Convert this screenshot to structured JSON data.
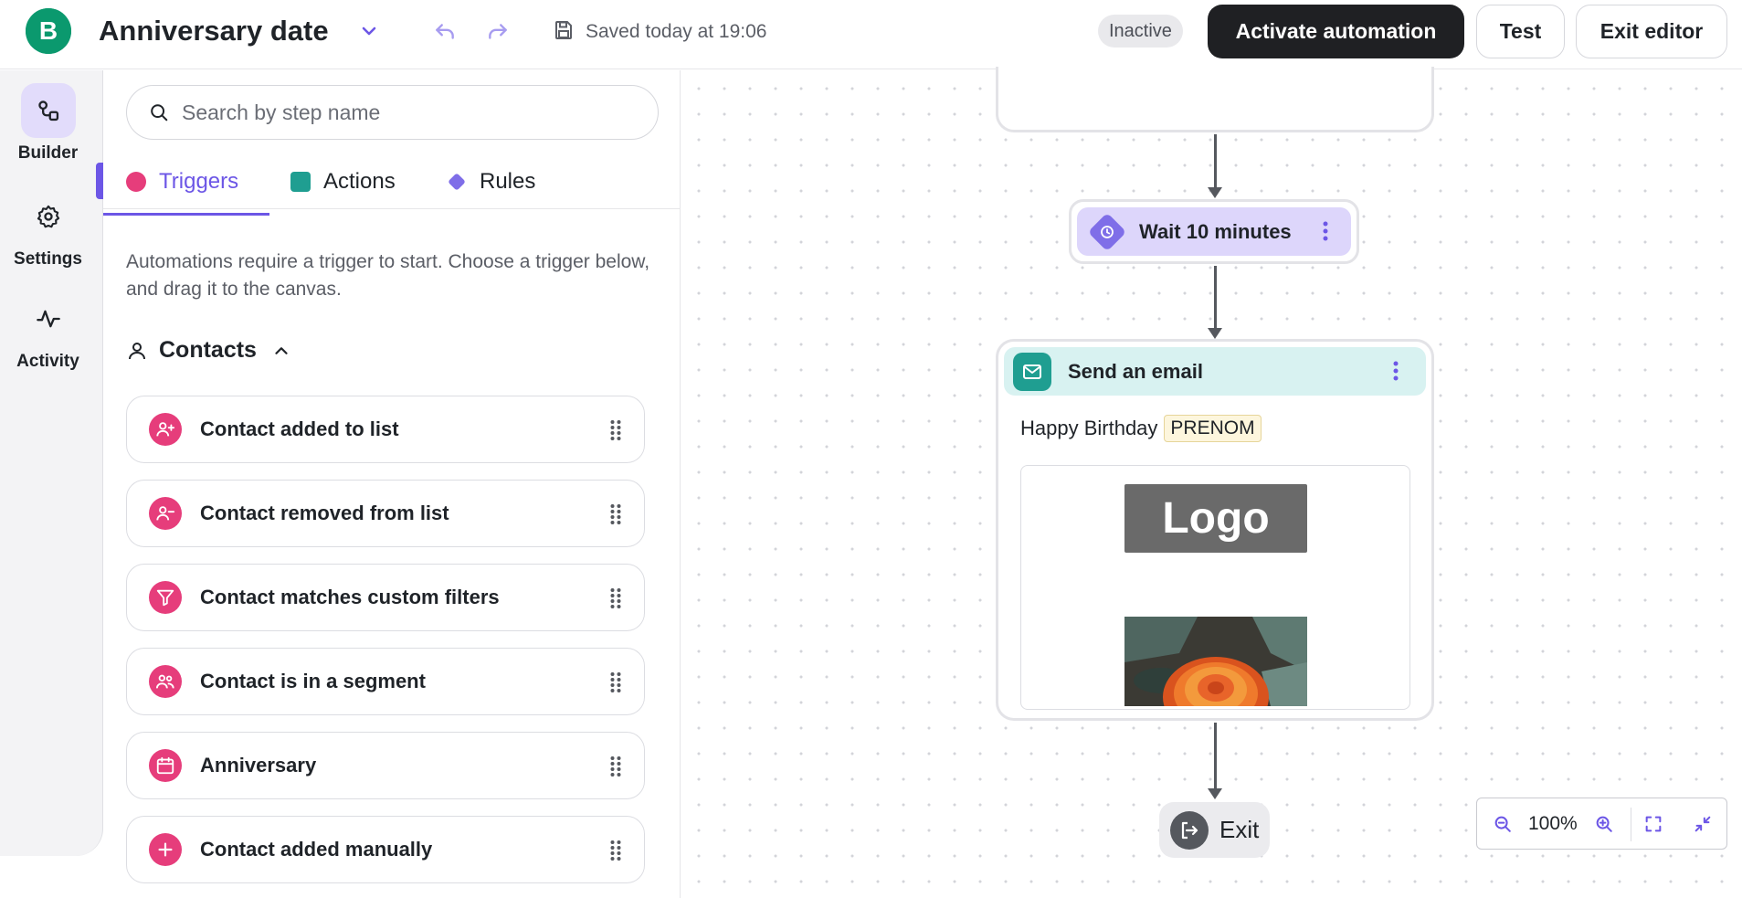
{
  "header": {
    "brand_letter": "B",
    "title": "Anniversary date",
    "saved_text": "Saved today at 19:06",
    "status_badge": "Inactive",
    "activate_label": "Activate automation",
    "test_label": "Test",
    "exit_editor_label": "Exit editor"
  },
  "rail": {
    "items": [
      {
        "label": "Builder",
        "icon": "builder-icon",
        "active": true
      },
      {
        "label": "Settings",
        "icon": "gear-icon",
        "active": false
      },
      {
        "label": "Activity",
        "icon": "activity-icon",
        "active": false
      }
    ]
  },
  "panel": {
    "search_placeholder": "Search by step name",
    "tabs": [
      {
        "label": "Triggers",
        "color": "#e63d7b",
        "active": true
      },
      {
        "label": "Actions",
        "color": "#1f9e91",
        "active": false
      },
      {
        "label": "Rules",
        "color": "#7f6ee8",
        "active": false
      }
    ],
    "hint": "Automations require a trigger to start. Choose a trigger below, and drag it to the canvas.",
    "group_title": "Contacts",
    "items": [
      {
        "label": "Contact added to list",
        "icon": "person-plus-icon"
      },
      {
        "label": "Contact removed from list",
        "icon": "person-minus-icon"
      },
      {
        "label": "Contact matches custom filters",
        "icon": "filter-icon"
      },
      {
        "label": "Contact is in a segment",
        "icon": "people-icon"
      },
      {
        "label": "Anniversary",
        "icon": "calendar-icon"
      },
      {
        "label": "Contact added manually",
        "icon": "plus-icon"
      }
    ]
  },
  "canvas": {
    "wait_label": "Wait 10 minutes",
    "email_label": "Send an email",
    "email_subject": "Happy Birthday",
    "email_tag": "PRENOM",
    "logo_text": "Logo",
    "exit_label": "Exit",
    "zoom_value": "100%"
  },
  "colors": {
    "accent": "#6c56e6",
    "trigger": "#e63d7b",
    "action": "#1f9e91",
    "rule": "#7f6ee8",
    "brand": "#0b996e"
  }
}
